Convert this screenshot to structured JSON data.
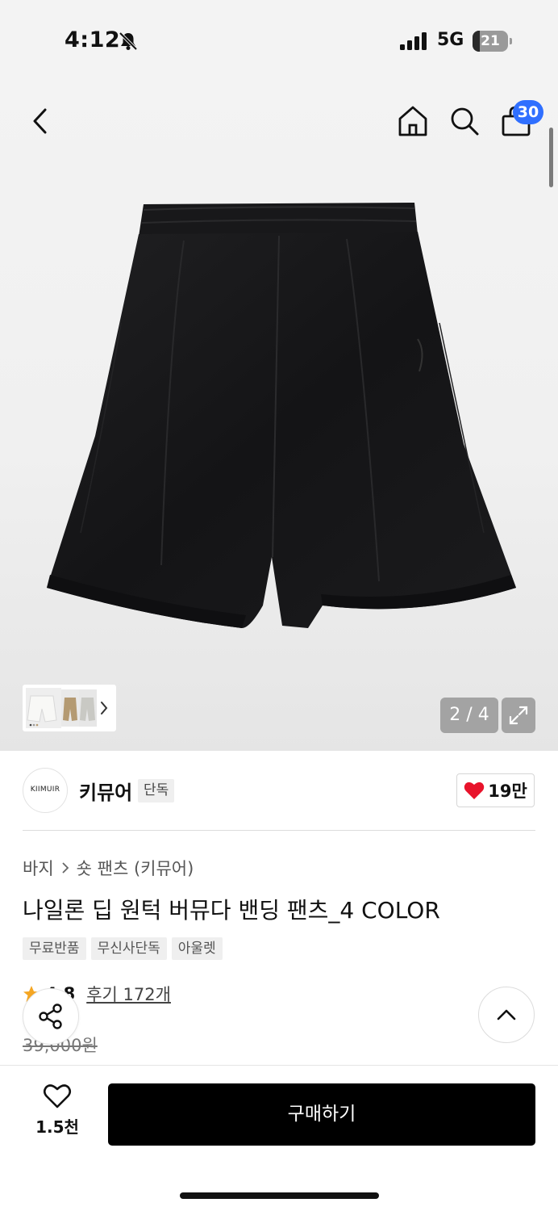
{
  "status_bar": {
    "time": "4:12",
    "network": "5G",
    "battery": "21",
    "battery_fraction": 0.21
  },
  "header": {
    "cart_count": "30"
  },
  "gallery": {
    "counter": "2 / 4"
  },
  "brand": {
    "logo_text": "KIIMUIR",
    "name": "키뮤어",
    "tag": "단독",
    "like_count": "19만"
  },
  "breadcrumb": {
    "category": "바지",
    "subcategory": "숏 팬츠 (키뮤어)"
  },
  "product": {
    "title": "나일론 딥 원턱 버뮤다 밴딩 팬츠_4 COLOR",
    "tags": [
      "무료반품",
      "무신사단독",
      "아울렛"
    ],
    "rating": "4.8",
    "review_label": "후기 172개",
    "original_price": "39,000원"
  },
  "bottom_bar": {
    "wish_count": "1.5천",
    "buy_label": "구매하기"
  },
  "colors": {
    "accent": "#2f6fff",
    "heart": "#e8132b",
    "buy": "#000000"
  },
  "icons": [
    "bell-off-icon",
    "signal-icon",
    "back-icon",
    "home-icon",
    "search-icon",
    "shopping-bag-icon",
    "expand-icon",
    "chevron-right-icon",
    "heart-icon",
    "star-icon",
    "share-icon",
    "chevron-up-icon"
  ]
}
